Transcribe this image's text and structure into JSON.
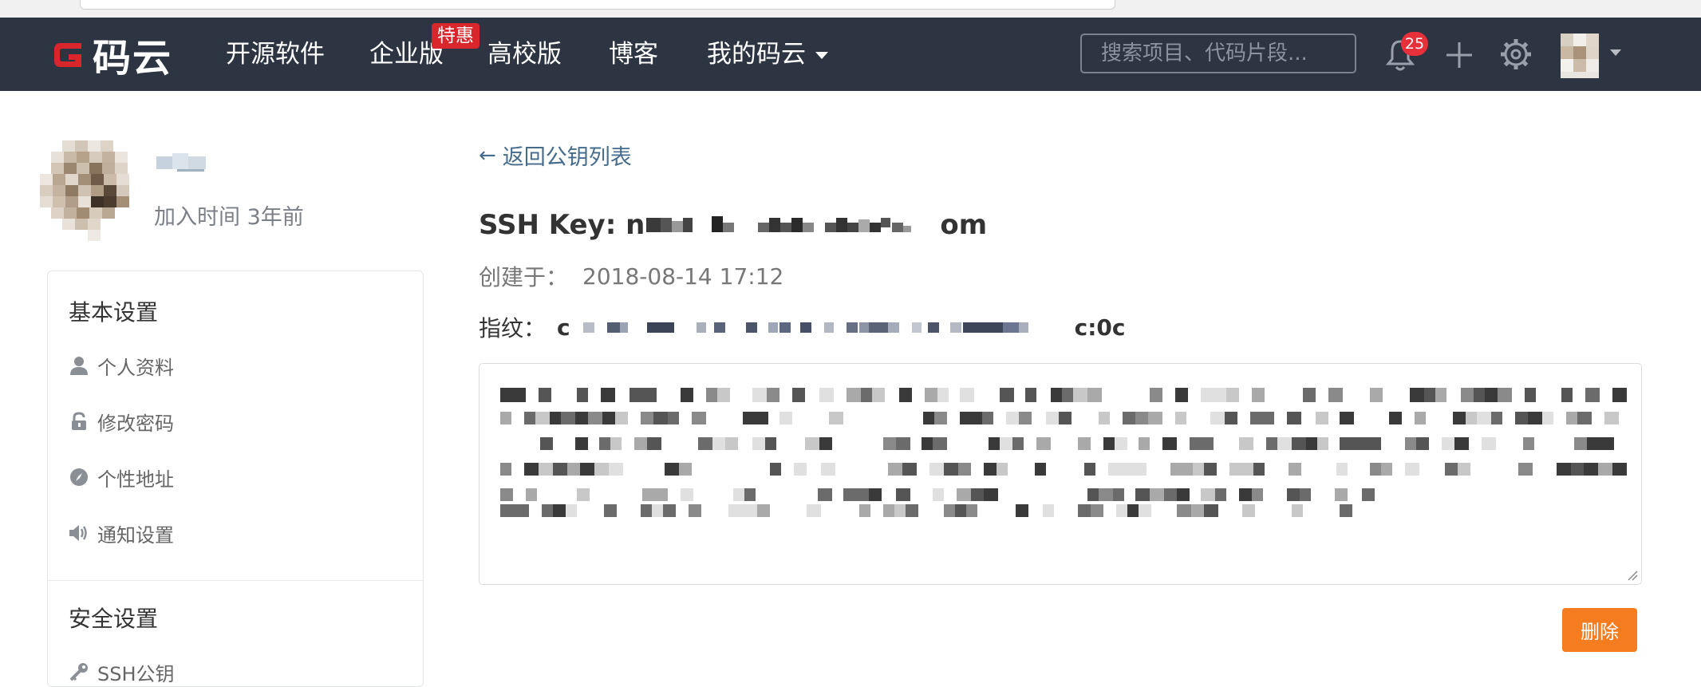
{
  "navbar": {
    "logo_text": "码云",
    "items": [
      {
        "label": "开源软件"
      },
      {
        "label": "企业版"
      },
      {
        "label": "高校版"
      },
      {
        "label": "博客"
      },
      {
        "label": "我的码云"
      }
    ],
    "enterprise_badge": "特惠",
    "search_placeholder": "搜索项目、代码片段...",
    "notification_count": "25",
    "icons": [
      "bell-icon",
      "plus-icon",
      "gear-icon",
      "avatar",
      "chevron-down-icon"
    ]
  },
  "profile": {
    "join_time": "加入时间 3年前"
  },
  "sidebar": {
    "groups": [
      {
        "title": "基本设置",
        "items": [
          {
            "label": "个人资料",
            "icon": "user-icon"
          },
          {
            "label": "修改密码",
            "icon": "unlock-icon"
          },
          {
            "label": "个性地址",
            "icon": "compass-icon"
          },
          {
            "label": "通知设置",
            "icon": "speaker-icon"
          }
        ]
      },
      {
        "title": "安全设置",
        "items": [
          {
            "label": "SSH公钥",
            "icon": "key-icon"
          }
        ]
      }
    ]
  },
  "main": {
    "back_label": "返回公钥列表",
    "ssh_title_prefix": "SSH Key: n",
    "ssh_title_suffix": "om",
    "created_label": "创建于：",
    "created_value": "2018-08-14 17:12",
    "fingerprint_label": "指纹：",
    "fingerprint_prefix": "c",
    "fingerprint_suffix": "c:0c",
    "delete_label": "删除"
  },
  "colors": {
    "navbar_bg": "#2d3442",
    "brand_red": "#d9262c",
    "link_blue": "#466c8d",
    "delete_orange": "#f57d1f"
  }
}
